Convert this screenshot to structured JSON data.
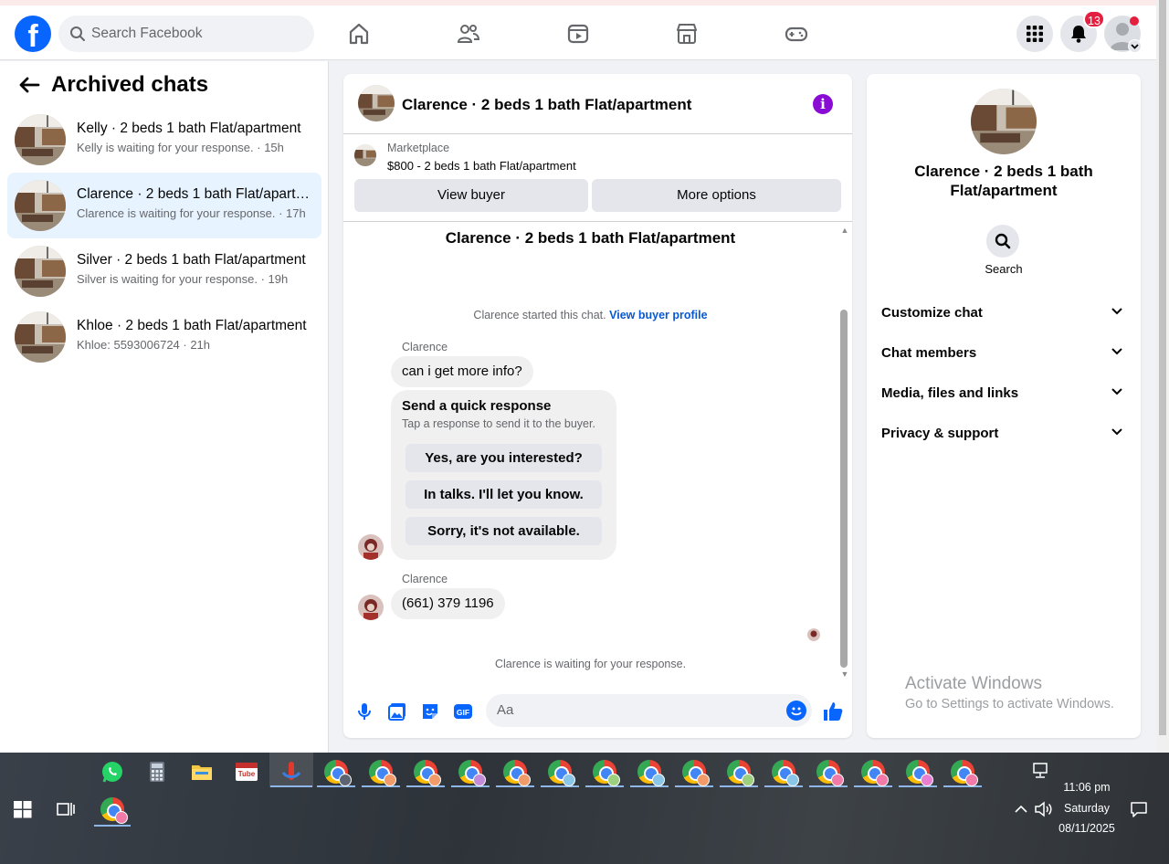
{
  "topbar": {
    "logo": "f",
    "search_placeholder": "Search Facebook",
    "notification_count": "13",
    "nav_icons": [
      "home-icon",
      "friends-icon",
      "video-icon",
      "marketplace-icon",
      "gaming-icon"
    ]
  },
  "sidebar": {
    "title": "Archived chats",
    "chats": [
      {
        "name": "Kelly · 2 beds 1 bath Flat/apartment",
        "preview": "Kelly is waiting for your response. · 15h"
      },
      {
        "name": "Clarence · 2 beds 1 bath Flat/apartment",
        "preview": "Clarence is waiting for your response. · 17h"
      },
      {
        "name": "Silver · 2 beds 1 bath Flat/apartment",
        "preview": "Silver is waiting for your response. · 19h"
      },
      {
        "name": "Khloe · 2 beds 1 bath Flat/apartment",
        "preview": "Khloe: 5593006724 · 21h"
      }
    ]
  },
  "conversation": {
    "header_title": "Clarence · 2 beds 1 bath Flat/apartment",
    "marketplace_label": "Marketplace",
    "listing": "$800 - 2 beds 1 bath Flat/apartment",
    "view_buyer": "View buyer",
    "more_options": "More options",
    "title": "Clarence · 2 beds 1 bath Flat/apartment",
    "started_text": "Clarence started this chat.",
    "buyer_profile_link": "View buyer profile",
    "sender1": "Clarence",
    "message1": "can i get more info?",
    "quick_title": "Send a quick response",
    "quick_sub": "Tap a response to send it to the buyer.",
    "quick_responses": [
      "Yes, are you interested?",
      "In talks. I'll let you know.",
      "Sorry, it's not available."
    ],
    "sender2": "Clarence",
    "message2": "(661) 379 1196",
    "waiting": "Clarence is waiting for your response.",
    "input_placeholder": "Aa"
  },
  "details": {
    "name": "Clarence · 2 beds 1 bath Flat/apartment",
    "search_label": "Search",
    "sections": [
      "Customize chat",
      "Chat members",
      "Media, files and links",
      "Privacy & support"
    ]
  },
  "watermark": {
    "line1": "Activate Windows",
    "line2": "Go to Settings to activate Windows."
  },
  "taskbar": {
    "time": "11:06 pm",
    "day": "Saturday",
    "date": "08/11/2025"
  },
  "colors": {
    "facebook_blue": "#0866ff",
    "active_row": "#e7f3ff",
    "info_purple": "#8a0bd4",
    "badge_red": "#e41e3f"
  }
}
